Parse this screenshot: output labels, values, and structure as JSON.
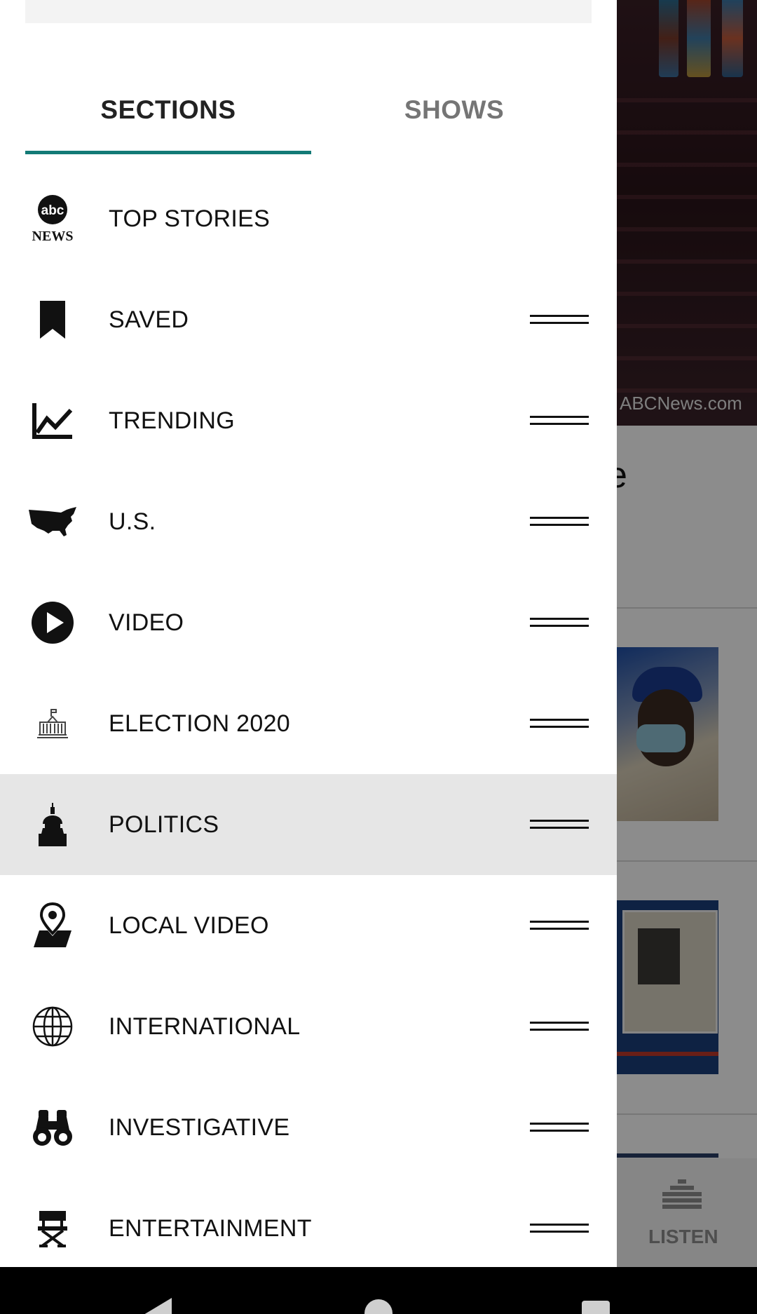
{
  "background": {
    "hero_credit": "ABCNews.com",
    "headline_fragment": "e",
    "bottom_nav": {
      "listen_label": "LISTEN",
      "listen_icon": "equalizer-icon"
    }
  },
  "drawer": {
    "tabs": [
      {
        "label": "SECTIONS",
        "active": true
      },
      {
        "label": "SHOWS",
        "active": false
      }
    ],
    "accent_color": "#137a76",
    "items": [
      {
        "label": "TOP STORIES",
        "icon": "abc-news-logo-icon",
        "draggable": false,
        "selected": false
      },
      {
        "label": "SAVED",
        "icon": "bookmark-icon",
        "draggable": true,
        "selected": false
      },
      {
        "label": "TRENDING",
        "icon": "trending-chart-icon",
        "draggable": true,
        "selected": false
      },
      {
        "label": "U.S.",
        "icon": "usa-map-icon",
        "draggable": true,
        "selected": false
      },
      {
        "label": "VIDEO",
        "icon": "play-icon",
        "draggable": true,
        "selected": false
      },
      {
        "label": "ELECTION 2020",
        "icon": "white-house-icon",
        "draggable": true,
        "selected": false
      },
      {
        "label": "POLITICS",
        "icon": "capitol-icon",
        "draggable": true,
        "selected": true
      },
      {
        "label": "LOCAL VIDEO",
        "icon": "map-pin-icon",
        "draggable": true,
        "selected": false
      },
      {
        "label": "INTERNATIONAL",
        "icon": "globe-icon",
        "draggable": true,
        "selected": false
      },
      {
        "label": "INVESTIGATIVE",
        "icon": "binoculars-icon",
        "draggable": true,
        "selected": false
      },
      {
        "label": "ENTERTAINMENT",
        "icon": "directors-chair-icon",
        "draggable": true,
        "selected": false
      }
    ],
    "abc_logo_text": {
      "top": "abc",
      "bottom": "NEWS"
    }
  },
  "system_nav": {
    "back_icon": "back-icon",
    "home_icon": "home-icon",
    "recents_icon": "recents-icon"
  }
}
